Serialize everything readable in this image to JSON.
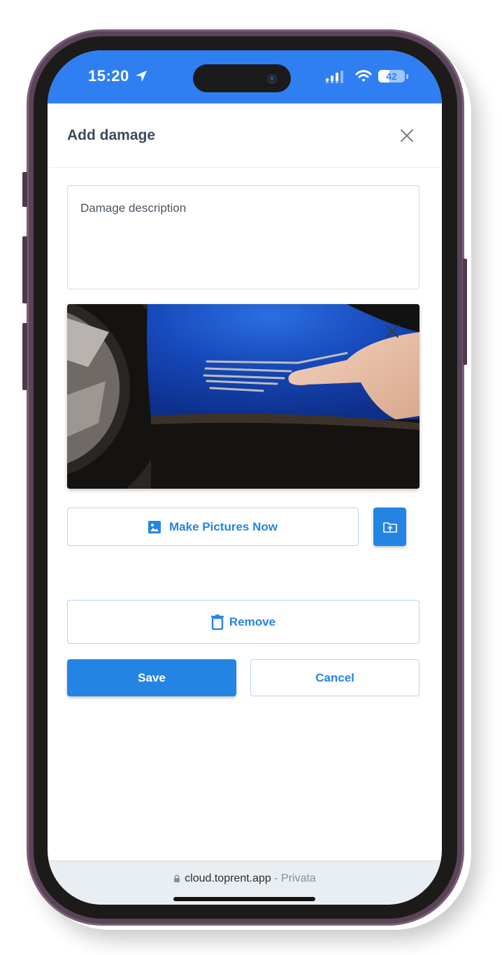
{
  "status_bar": {
    "time": "15:20",
    "battery_percent": "42",
    "battery_level": 0.42,
    "icons": [
      "location-arrow-icon",
      "signal-icon",
      "wifi-icon",
      "battery-icon"
    ]
  },
  "modal": {
    "title": "Add damage",
    "close_icon": "close-icon"
  },
  "description": {
    "placeholder": "Damage description",
    "value": ""
  },
  "photo": {
    "alt": "Scratched blue car bumper near the rear wheel with a finger pointing at the scratch",
    "remove_icon": "close-icon"
  },
  "actions": {
    "make_pictures_label": "Make Pictures Now",
    "make_pictures_icon": "image-icon",
    "upload_icon": "folder-upload-icon",
    "remove_label": "Remove",
    "remove_icon": "trash-icon",
    "save_label": "Save",
    "cancel_label": "Cancel"
  },
  "browser": {
    "url": "cloud.toprent.app",
    "separator": " - ",
    "mode": "Privata",
    "lock_icon": "lock-icon"
  },
  "colors": {
    "status_bar": "#2f7ff2",
    "primary": "#2484e4",
    "title_text": "#3d4b5a",
    "phone_frame": "#5a4458"
  }
}
